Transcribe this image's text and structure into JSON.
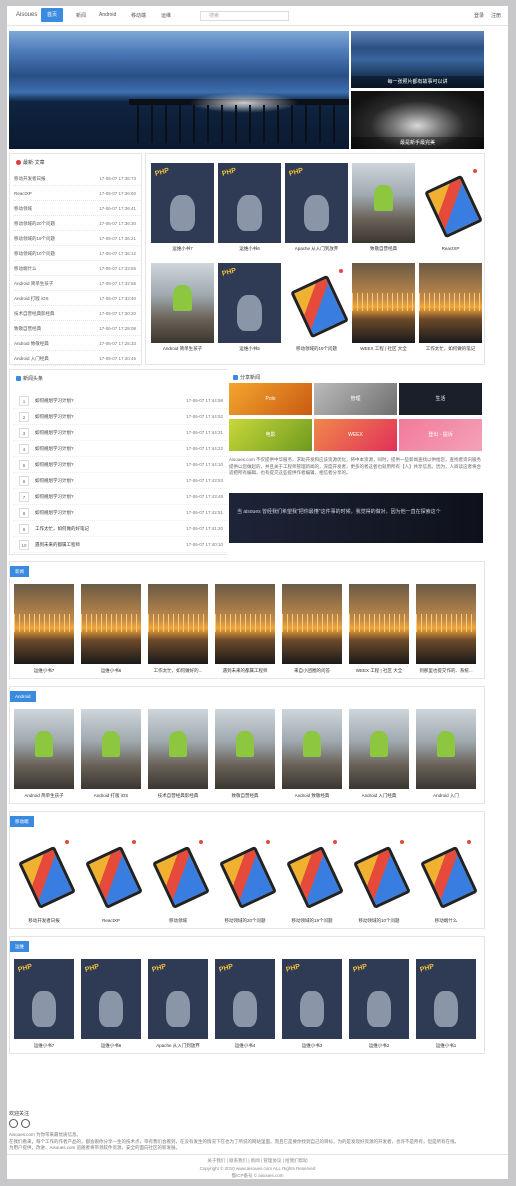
{
  "nav": {
    "logo": "Aisoues",
    "items": [
      "首页",
      "新闻",
      "Android",
      "移动端",
      "运维"
    ],
    "search_placeholder": "搜索",
    "login": "登录",
    "register": "注册"
  },
  "banner": {
    "side1_caption": "每一张照片都有故事可以讲",
    "side2_caption": "最是新手最完美"
  },
  "latest": {
    "title": "最新·文章",
    "rows": [
      {
        "t": "移动开发者日报",
        "d": "17-06-07 17:36:73"
      },
      {
        "t": "ReactXP",
        "d": "17-06-07 17:36:60"
      },
      {
        "t": "移动领域",
        "d": "17-06-07 17:36:41"
      },
      {
        "t": "移动领域的20个问题",
        "d": "17-06-07 17:36:30"
      },
      {
        "t": "移动领域的19个问题",
        "d": "17-06-07 17:36:21"
      },
      {
        "t": "移动领域的10个问题",
        "d": "17-06-07 17:36:12"
      },
      {
        "t": "移动端什么",
        "d": "17-06-07 17:33:55"
      },
      {
        "t": "Android 简单生孩子",
        "d": "17-06-07 17:32:56"
      },
      {
        "t": "Android 打版 iOS",
        "d": "17-06-07 17:32:40"
      },
      {
        "t": "技术自营经典影经典",
        "d": "17-06-07 17:30:20"
      },
      {
        "t": "致敬自营经典",
        "d": "17-06-07 17:28:08"
      },
      {
        "t": "Android 致敬经典",
        "d": "17-06-07 17:25:33"
      },
      {
        "t": "Android 入门经典",
        "d": "17-06-07 17:20:45"
      }
    ]
  },
  "grid1": [
    "运维小书7",
    "运维小书6",
    "Apache 从入门到放弃",
    "致敬自营经典",
    "ReactXP",
    "Android 简单生孩子",
    "运维小书5",
    "移动领域的19个问题",
    "WEEX 工程 | 社区 大全",
    "工作太忙，如何做的笔记"
  ],
  "hot": {
    "title": "新闻头条",
    "rows": [
      {
        "t": "如何规划学习计划?",
        "d": "17-06-07 17:44:58"
      },
      {
        "t": "如何规划学习计划?",
        "d": "17-06-07 17:44:52"
      },
      {
        "t": "如何规划学习计划?",
        "d": "17-06-07 17:44:31"
      },
      {
        "t": "如何规划学习计划?",
        "d": "17-06-07 17:44:22"
      },
      {
        "t": "如何规划学习计划?",
        "d": "17-06-07 17:44:10"
      },
      {
        "t": "如何规划学习计划?",
        "d": "17-06-07 17:43:53"
      },
      {
        "t": "如何规划学习计划?",
        "d": "17-06-07 17:43:48"
      },
      {
        "t": "如何规划学习计划?",
        "d": "17-06-07 17:42:51"
      },
      {
        "t": "工作太忙，如何做的好笔记",
        "d": "17-06-07 17:41:20"
      },
      {
        "t": "遇到未来的都属工程师",
        "d": "17-06-07 17:40:10"
      }
    ]
  },
  "share": {
    "title": "分享新闻",
    "tiles": [
      "Polo",
      "管理",
      "生活",
      "电影",
      "WEEX",
      "登出 · 提诉"
    ],
    "paragraph": "Aisoues.com 不仅提供中华服务，求助开发和应该资源优化，将中本资源，同时，提供一些新闻查找以供给您，查找者资讯服务提供以您做起的，并且关于工程师管理新闻的，深度开发者，更多的者这者也就用所有【人】共享信息。因为，人阅读这者将合适把所有编辑，也有提交这些提供作者编辑，相信者分享的。",
    "quote": "当 aisoues 曾经我们希望我\"把你最懂\"这件事的时候，我觉得的做对，因为他一直在探索这个"
  },
  "sections": [
    {
      "label": "新闻",
      "items": [
        "运维小书7",
        "运维小书6",
        "工作太忙，如何做好的...",
        "遇到未来的都属工程师",
        "来自小团圈的问答",
        "WEEX 工程 | 社区 大全",
        "到那里也提交作的、系统..."
      ]
    },
    {
      "label": "Android",
      "items": [
        "Android 简单生孩子",
        "Android 打版 iOS",
        "技术自营经典影经典",
        "致敬自营经典",
        "Android 致敬经典",
        "Android 入门经典",
        "Android 入门"
      ]
    },
    {
      "label": "移动端",
      "items": [
        "移动开发者日报",
        "ReactXP",
        "移动领域",
        "移动领域的20个问题",
        "移动领域的19个问题",
        "移动领域的10个问题",
        "移动端什么"
      ]
    },
    {
      "label": "运维",
      "items": [
        "运维小书7",
        "运维小书6",
        "Apache 从入门到放弃",
        "运维小书4",
        "运维小书3",
        "运维小书2",
        "运维小书1"
      ]
    }
  ],
  "follow": {
    "title": "欢迎关注",
    "line1": "Aisoues.com 为你带来最优质信息。",
    "line2": "在我们看来，每个工作的作者产品的，都会跟你分享一生的技术点，带有我们会看到，在没有发生的情况下在也为了所说的网站里面，而且它是要你找到自己的目标，为的是发现好资源的开发者，也许不是所有，但是所有在线。",
    "line3": "为用户提供，改进、Aisoues.com 追随者将带领软件资源，安全的面向社区的新发展。"
  },
  "footer": {
    "links": "关于我们 | 联系我们 | 新闻 | 管理协议 | 给我们帮助",
    "copyright": "Copyright © 2010 www.aisoues.com ALL Rights Reserved",
    "icp": "蜀ICP备号 © aisoues.com"
  },
  "colors": {
    "accent": "#3a8be0",
    "latest_icon": "#e03a3a",
    "page_bg": "#c8c7c9"
  }
}
